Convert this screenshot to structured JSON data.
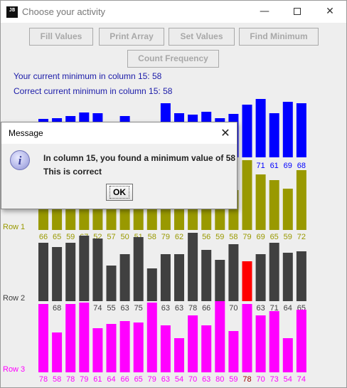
{
  "window": {
    "title": "Choose your activity",
    "app_icon_text": "JB",
    "min_glyph": "—",
    "close_glyph": "✕"
  },
  "buttons": {
    "fill_values": "Fill Values",
    "print_array": "Print Array",
    "set_values": "Set Values",
    "find_minimum": "Find Minimum",
    "count_frequency": "Count Frequency"
  },
  "info": {
    "current_min": "Your current minimum in column 15: 58",
    "correct_min": "Correct current minimum in column 15: 58"
  },
  "colors": {
    "row0": "#0000ff",
    "row1": "#999900",
    "row2": "#404040",
    "row3": "#ff00ff",
    "highlight_bar": "#ff0000",
    "highlight_text": "#a00000",
    "info_text": "#1a1aa8"
  },
  "chart_data": {
    "type": "bar",
    "highlight_column": 15,
    "rows": [
      {
        "label": "",
        "values": [
          null,
          null,
          null,
          null,
          null,
          null,
          null,
          null,
          null,
          null,
          null,
          null,
          null,
          null,
          null,
          67,
          71,
          61,
          69,
          68
        ],
        "bar_heights_hint": [
          54,
          55,
          58,
          63,
          62,
          47,
          58,
          46,
          47,
          76,
          62,
          60,
          64,
          55,
          61,
          62,
          66,
          58,
          65,
          63
        ]
      },
      {
        "label": "Row 1",
        "values": [
          66,
          65,
          59,
          67,
          52,
          57,
          50,
          51,
          58,
          79,
          62,
          71,
          56,
          59,
          58,
          79,
          69,
          65,
          59,
          72
        ]
      },
      {
        "label": "Row 2",
        "values": [
          71,
          68,
          71,
          76,
          74,
          55,
          63,
          75,
          53,
          63,
          63,
          78,
          66,
          59,
          70,
          58,
          63,
          71,
          64,
          65
        ]
      },
      {
        "label": "Row 3",
        "values": [
          78,
          58,
          78,
          79,
          61,
          64,
          66,
          65,
          79,
          63,
          54,
          70,
          63,
          80,
          59,
          78,
          70,
          73,
          54,
          74
        ]
      }
    ]
  },
  "dialog": {
    "title": "Message",
    "close_glyph": "✕",
    "icon_glyph": "i",
    "line1": "In column 15, you found a minimum value of 58",
    "line2": "This is correct",
    "ok_label": "OK"
  }
}
